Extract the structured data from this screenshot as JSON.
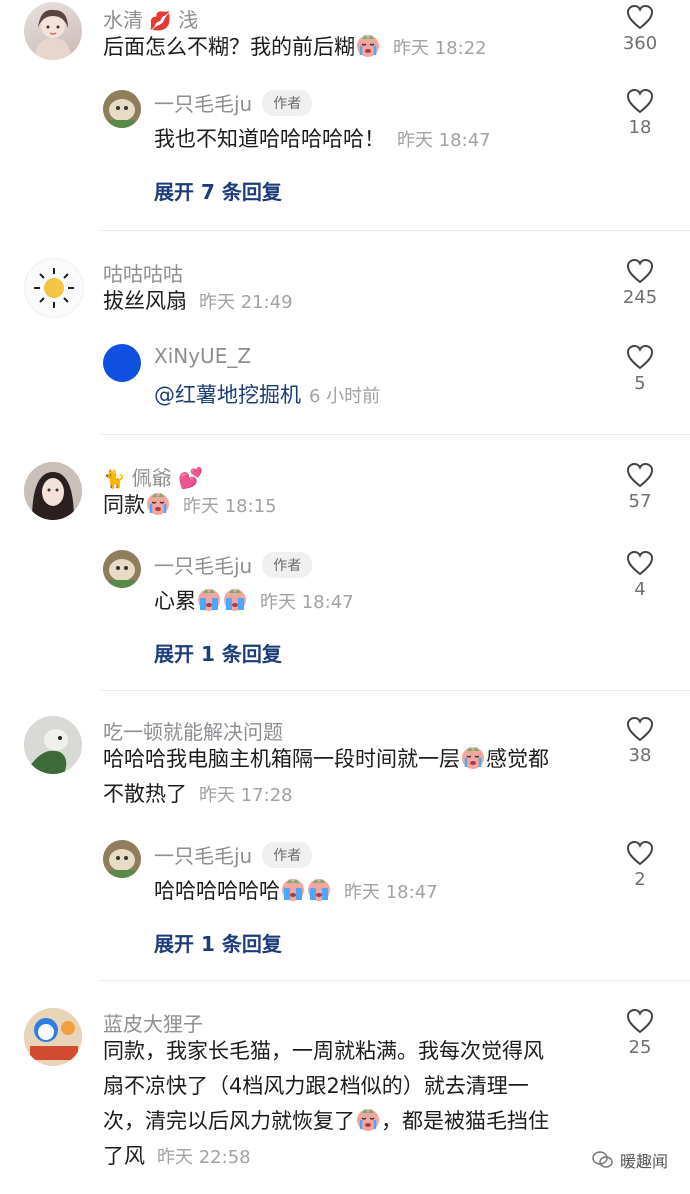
{
  "threads": [
    {
      "comment": {
        "name": "水清",
        "name_suffix": "浅",
        "text": "后面怎么不糊？我的前后糊",
        "time": "昨天 18:22",
        "likes": "360"
      },
      "replies": [
        {
          "name": "一只毛毛ju",
          "tag": "作者",
          "text": "我也不知道哈哈哈哈哈！",
          "time": "昨天 18:47",
          "likes": "18"
        }
      ],
      "expand": "展开 7 条回复"
    },
    {
      "comment": {
        "name": "咕咕咕咕",
        "text": "拔丝风扇",
        "time": "昨天 21:49",
        "likes": "245"
      },
      "replies": [
        {
          "name": "XiNyUE_Z",
          "text": "@红薯地挖掘机",
          "time": "6 小时前",
          "likes": "5"
        }
      ]
    },
    {
      "comment": {
        "name": "佩爺",
        "text": "同款",
        "time": "昨天 18:15",
        "likes": "57"
      },
      "replies": [
        {
          "name": "一只毛毛ju",
          "tag": "作者",
          "text": "心累",
          "time": "昨天 18:47",
          "likes": "4"
        }
      ],
      "expand": "展开 1 条回复"
    },
    {
      "comment": {
        "name": "吃一顿就能解决问题",
        "text_line1": "哈哈哈我电脑主机箱隔一段时间就一层",
        "text_line1_after": "感觉都",
        "text_line2": "不散热了",
        "time": "昨天 17:28",
        "likes": "38"
      },
      "replies": [
        {
          "name": "一只毛毛ju",
          "tag": "作者",
          "text": "哈哈哈哈哈哈",
          "time": "昨天 18:47",
          "likes": "2"
        }
      ],
      "expand": "展开 1 条回复"
    },
    {
      "comment": {
        "name": "蓝皮大狸子",
        "text_line1": "同款，我家长毛猫，一周就粘满。我每次觉得风",
        "text_line2": "扇不凉快了（4档风力跟2档似的）就去清理一",
        "text_line3": "次，清完以后风力就恢复了",
        "text_line3_after": "，都是被猫毛挡住",
        "text_line4": "了风",
        "time": "昨天 22:58",
        "likes": "25"
      }
    }
  ],
  "watermark": "暖趣闻",
  "colors": {
    "link": "#1d3d7a",
    "meta": "#a2a2a6",
    "name": "#8e8e93",
    "avatar_blue": "#1050e0"
  }
}
